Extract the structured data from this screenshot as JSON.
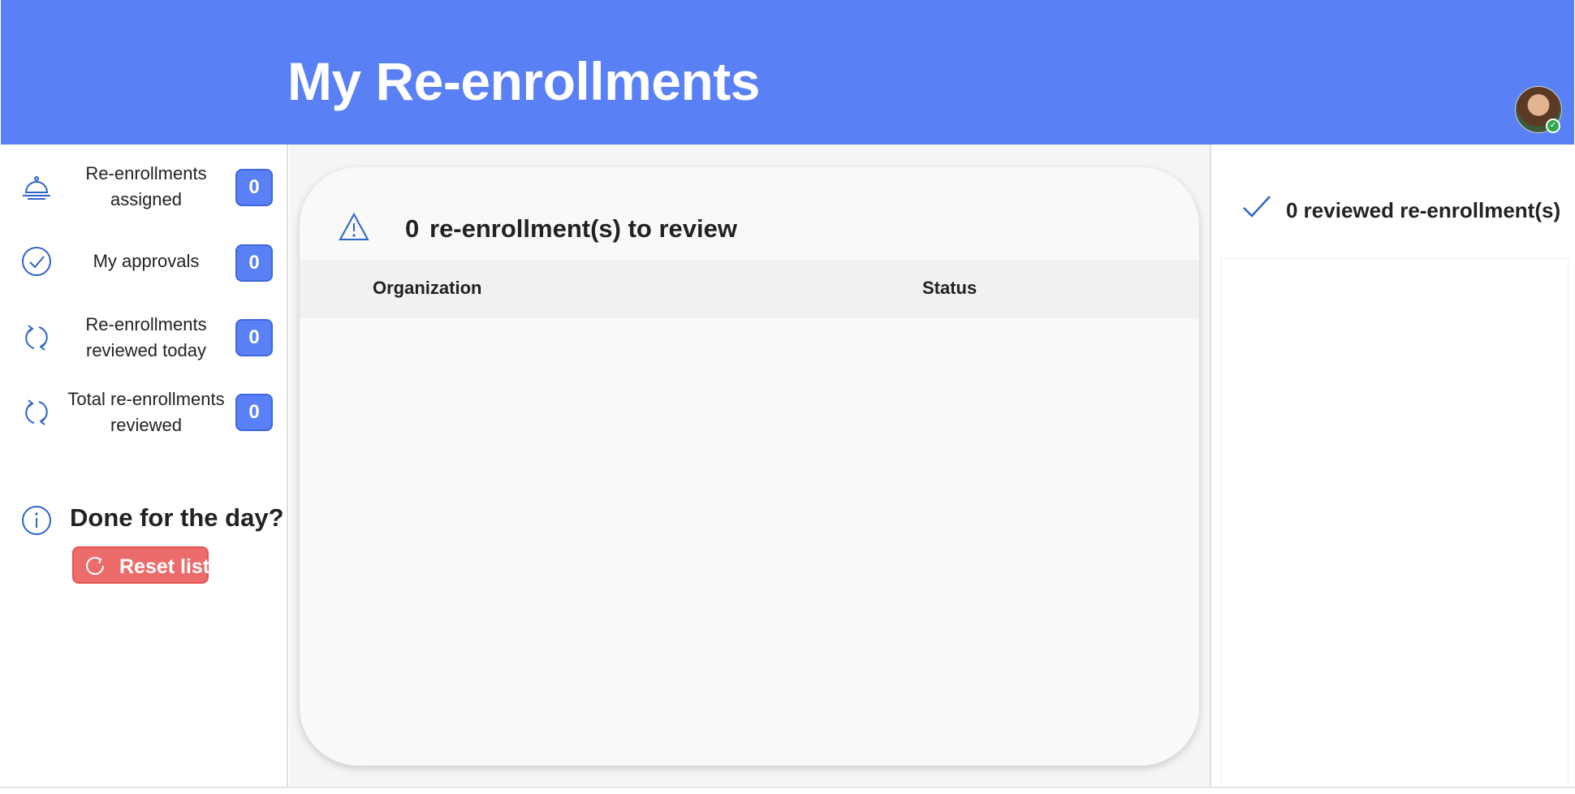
{
  "header": {
    "title": "My Re-enrollments",
    "accent_color": "#5a80f5",
    "avatar_status": "online"
  },
  "sidebar": {
    "stats": [
      {
        "icon": "bell-icon",
        "label": "Re-enrollments assigned",
        "count": "0"
      },
      {
        "icon": "check-circle-icon",
        "label": "My approvals",
        "count": "0"
      },
      {
        "icon": "refresh-icon",
        "label": "Re-enrollments reviewed today",
        "count": "0"
      },
      {
        "icon": "refresh-icon",
        "label": "Total re-enrollments reviewed",
        "count": "0"
      }
    ],
    "done": {
      "icon": "info-icon",
      "title": "Done for the day?",
      "reset_label": "Reset list",
      "reset_color": "#ec6b6b"
    }
  },
  "main": {
    "icon": "warning-icon",
    "count": "0",
    "title": "re-enrollment(s) to review",
    "columns": [
      "Organization",
      "Status"
    ],
    "rows": []
  },
  "right_panel": {
    "icon": "checkmark-icon",
    "title": "0 reviewed re-enrollment(s)",
    "items": []
  }
}
